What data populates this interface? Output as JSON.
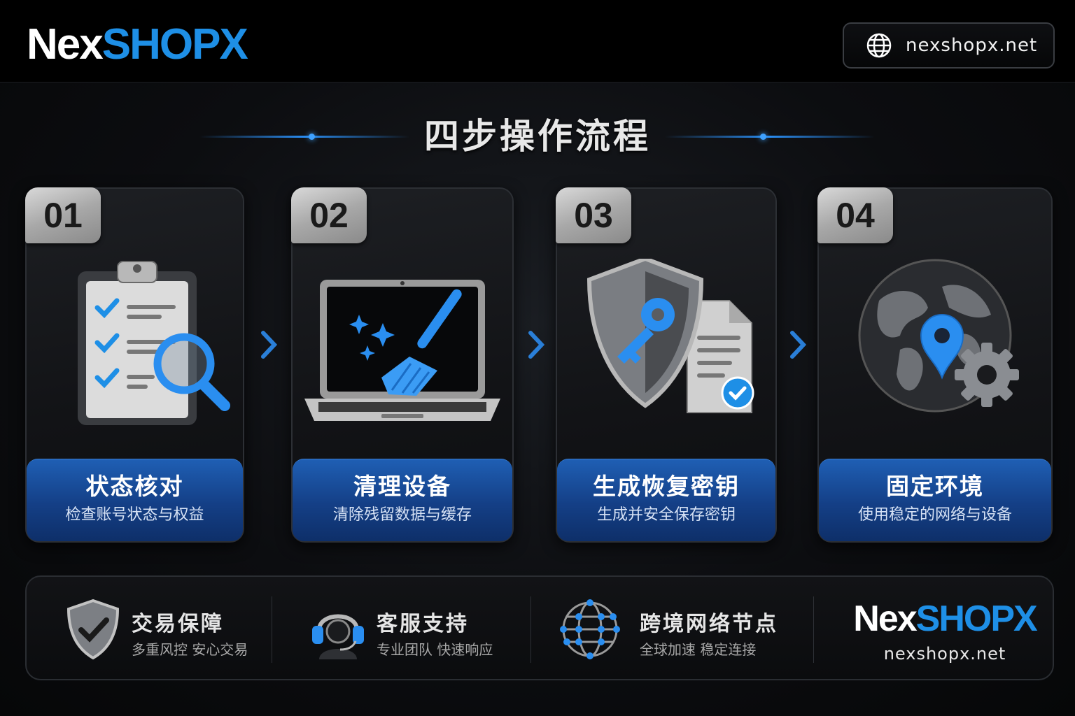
{
  "header": {
    "logo_part1": "Nex",
    "logo_part2": "SHOPX",
    "site_label": "nexshopx.net"
  },
  "title": "四步操作流程",
  "steps": [
    {
      "number": "01",
      "title": "状态核对",
      "subtitle": "检查账号状态与权益",
      "icon": "clipboard-checklist-magnifier-icon"
    },
    {
      "number": "02",
      "title": "清理设备",
      "subtitle": "清除残留数据与缓存",
      "icon": "laptop-broom-icon"
    },
    {
      "number": "03",
      "title": "生成恢复密钥",
      "subtitle": "生成并安全保存密钥",
      "icon": "shield-key-document-icon"
    },
    {
      "number": "04",
      "title": "固定环境",
      "subtitle": "使用稳定的网络与设备",
      "icon": "globe-pin-gear-icon"
    }
  ],
  "features": [
    {
      "title": "交易保障",
      "subtitle": "多重风控 安心交易",
      "icon": "shield-check-icon"
    },
    {
      "title": "客服支持",
      "subtitle": "专业团队 快速响应",
      "icon": "headset-agent-icon"
    },
    {
      "title": "跨境网络节点",
      "subtitle": "全球加速 稳定连接",
      "icon": "network-globe-icon"
    }
  ],
  "footer": {
    "logo_part1": "Nex",
    "logo_part2": "SHOPX",
    "site_label": "nexshopx.net"
  },
  "colors": {
    "brand_blue": "#1e8fe6",
    "label_blue": "#1f5fb4",
    "background": "#08090b"
  }
}
